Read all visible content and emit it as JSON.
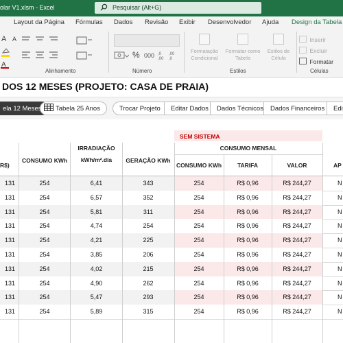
{
  "titlebar": {
    "filename": "olar V1.xlsm  -  Excel",
    "search_placeholder": "Pesquisar (Alt+G)"
  },
  "tabs": [
    "Layout da Página",
    "Fórmulas",
    "Dados",
    "Revisão",
    "Exibir",
    "Desenvolvedor",
    "Ajuda",
    "Design da Tabela"
  ],
  "ribbon": {
    "alignment_label": "Alinhamento",
    "number_label": "Número",
    "percent_symbol": "%",
    "thousands_symbol": "000",
    "styles_label": "Estilos",
    "cond_format": "Formatação Condicional",
    "format_table": "Formatar como Tabela",
    "cell_styles": "Estilos de Célula",
    "cells_label": "Células",
    "insert": "Inserir",
    "delete": "Excluir",
    "format": "Formatar"
  },
  "doc_title": "DOS 12 MESES (PROJETO: CASA DE PRAIA)",
  "nav": {
    "tabela12": "ela 12 Meses",
    "tabela25": "Tabela 25 Anos",
    "trocar": "Trocar Projeto",
    "editar": "Editar Dados",
    "tecnicos": "Dados Técnicos",
    "financeiros": "Dados Financeiros",
    "edit_cut": "Edita"
  },
  "table": {
    "sem_sistema": "SEM SISTEMA",
    "consumo_mensal": "CONSUMO MENSAL",
    "col_rs": "R$)",
    "col_consumo": "CONSUMO KWh",
    "col_irr1": "IRRADIAÇÃO",
    "col_irr2": "kWh/m².dia",
    "col_geracao": "GERAÇÃO KWh",
    "col_consumo2": "CONSUMO KWh",
    "col_tarifa": "TARIFA",
    "col_valor": "VALOR",
    "col_ap": "AP",
    "rows": [
      {
        "a": "131",
        "b": "254",
        "c": "6,41",
        "d": "343",
        "e": "254",
        "f": "R$ 0,96",
        "g": "R$ 244,27",
        "h": "N"
      },
      {
        "a": "131",
        "b": "254",
        "c": "6,57",
        "d": "352",
        "e": "254",
        "f": "R$ 0,96",
        "g": "R$ 244,27",
        "h": "N"
      },
      {
        "a": "131",
        "b": "254",
        "c": "5,81",
        "d": "311",
        "e": "254",
        "f": "R$ 0,96",
        "g": "R$ 244,27",
        "h": "N"
      },
      {
        "a": "131",
        "b": "254",
        "c": "4,74",
        "d": "254",
        "e": "254",
        "f": "R$ 0,96",
        "g": "R$ 244,27",
        "h": "N"
      },
      {
        "a": "131",
        "b": "254",
        "c": "4,21",
        "d": "225",
        "e": "254",
        "f": "R$ 0,96",
        "g": "R$ 244,27",
        "h": "N"
      },
      {
        "a": "131",
        "b": "254",
        "c": "3,85",
        "d": "206",
        "e": "254",
        "f": "R$ 0,96",
        "g": "R$ 244,27",
        "h": "N"
      },
      {
        "a": "131",
        "b": "254",
        "c": "4,02",
        "d": "215",
        "e": "254",
        "f": "R$ 0,96",
        "g": "R$ 244,27",
        "h": "N"
      },
      {
        "a": "131",
        "b": "254",
        "c": "4,90",
        "d": "262",
        "e": "254",
        "f": "R$ 0,96",
        "g": "R$ 244,27",
        "h": "N"
      },
      {
        "a": "131",
        "b": "254",
        "c": "5,47",
        "d": "293",
        "e": "254",
        "f": "R$ 0,96",
        "g": "R$ 244,27",
        "h": "N"
      },
      {
        "a": "131",
        "b": "254",
        "c": "5,89",
        "d": "315",
        "e": "254",
        "f": "R$ 0,96",
        "g": "R$ 244,27",
        "h": "N"
      }
    ]
  },
  "colors": {
    "excel_green": "#217346",
    "pink_band": "#fbe9ea",
    "grey_band": "#f2f2f2",
    "red_text": "#c00000"
  }
}
